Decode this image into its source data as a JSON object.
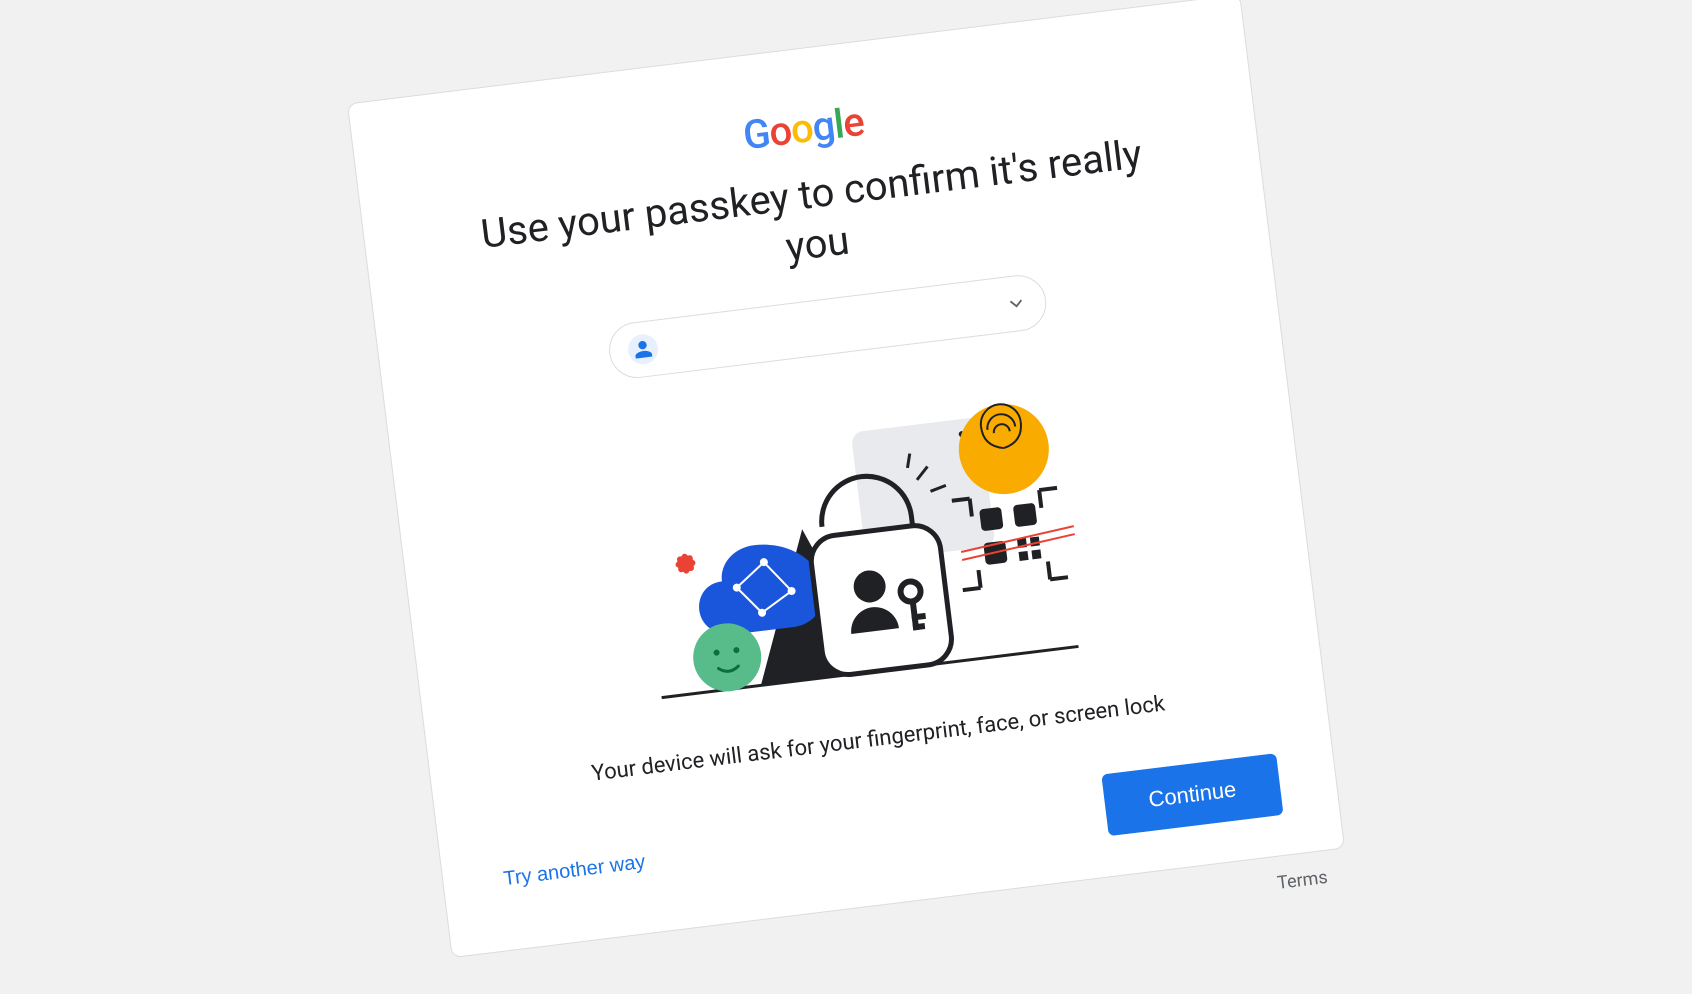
{
  "brand": "Google",
  "title": "Use your passkey to confirm it's really you",
  "account_chip": {
    "selected_account": ""
  },
  "description": "Your device will ask for your fingerprint, face, or screen lock",
  "buttons": {
    "try_another": "Try another way",
    "continue": "Continue"
  },
  "footer": {
    "terms": "Terms"
  },
  "colors": {
    "primary": "#1a73e8",
    "text": "#202124",
    "border": "#dadce0",
    "bg": "#f1f1f1"
  }
}
